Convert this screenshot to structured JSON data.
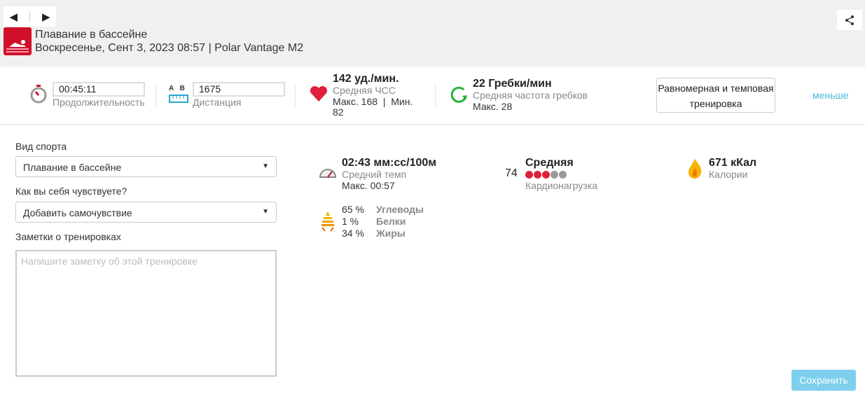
{
  "header": {
    "prev": "◀",
    "next": "▶",
    "sport_title": "Плавание в бассейне",
    "subtitle": "Воскресенье, Сент 3, 2023 08:57 | Polar Vantage M2"
  },
  "stats": {
    "duration": {
      "value": "00:45:11",
      "label": "Продолжительность"
    },
    "distance": {
      "value": "1675",
      "label": "Дистанция",
      "a": "A",
      "b": "B"
    },
    "hr": {
      "value": "142 уд./мин.",
      "label": "Средняя ЧСС",
      "minmax": "Макс. 168  |  Мин.",
      "min": "82"
    },
    "stroke": {
      "value": "22 Гребки/мин",
      "label": "Средняя частота гребков",
      "max": "Макс. 28"
    },
    "training_type": "Равномерная и темповая тренировка",
    "less": "меньше"
  },
  "form": {
    "sport_label": "Вид спорта",
    "sport_value": "Плавание в бассейне",
    "feeling_label": "Как вы себя чувствуете?",
    "feeling_value": "Добавить самочувствие",
    "notes_label": "Заметки о тренировках",
    "notes_placeholder": "Напишите заметку об этой тренировке"
  },
  "details": {
    "pace": {
      "value": "02:43 мм:сс/100м",
      "label": "Средний темп",
      "max": "Макс. 00:57"
    },
    "load": {
      "number": "74",
      "value": "Средняя",
      "label": "Кардионагрузка",
      "level": 3,
      "max": 5
    },
    "calories": {
      "value": "671 кКал",
      "label": "Калории"
    },
    "fuel": [
      {
        "pct": "65 %",
        "name": "Углеводы"
      },
      {
        "pct": "1 %",
        "name": "Белки"
      },
      {
        "pct": "34 %",
        "name": "Жиры"
      }
    ]
  },
  "save": "Сохранить",
  "colors": {
    "accent": "#d0102a",
    "link": "#4ab6d8",
    "save": "#7ecfee"
  }
}
